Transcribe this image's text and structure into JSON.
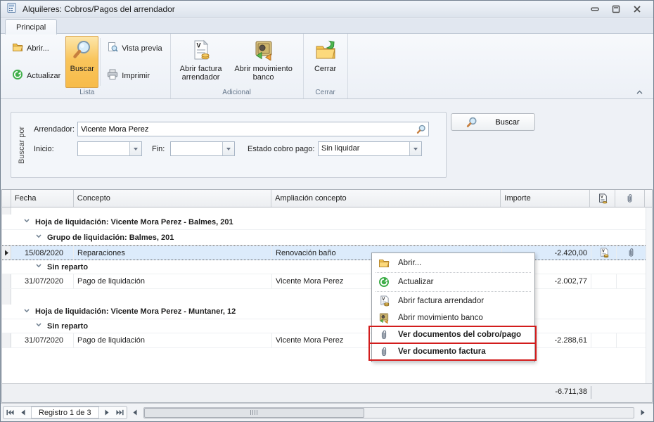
{
  "window": {
    "title": "Alquileres: Cobros/Pagos del arrendador"
  },
  "ribbon": {
    "tab": "Principal",
    "groups": {
      "lista": {
        "label": "Lista",
        "abrir": "Abrir...",
        "actualizar": "Actualizar",
        "buscar": "Buscar",
        "vista_previa": "Vista previa",
        "imprimir": "Imprimir"
      },
      "adicional": {
        "label": "Adicional",
        "abrir_factura": "Abrir factura arrendador",
        "abrir_movimiento": "Abrir movimiento banco"
      },
      "cerrar": {
        "label": "Cerrar",
        "cerrar": "Cerrar"
      }
    }
  },
  "search": {
    "side_label": "Buscar por",
    "arrendador_label": "Arrendador:",
    "arrendador_value": "Vicente Mora Perez",
    "inicio_label": "Inicio:",
    "inicio_value": "",
    "fin_label": "Fin:",
    "fin_value": "",
    "estado_label": "Estado cobro pago:",
    "estado_value": "Sin liquidar",
    "buscar_button": "Buscar"
  },
  "grid": {
    "columns": {
      "fecha": "Fecha",
      "concepto": "Concepto",
      "ampliacion": "Ampliación concepto",
      "importe": "Importe"
    },
    "rows": [
      {
        "type": "group",
        "level": 1,
        "label": "Hoja de liquidación: Vicente Mora Perez - Balmes, 201"
      },
      {
        "type": "group",
        "level": 2,
        "label": "Grupo de liquidación: Balmes, 201"
      },
      {
        "type": "data",
        "selected": true,
        "fecha": "15/08/2020",
        "concepto": "Reparaciones",
        "ampliacion": "Renovación baño",
        "importe": "-2.420,00",
        "factura_icon": true,
        "clip_icon": true
      },
      {
        "type": "group",
        "level": 2,
        "label": "Sin reparto"
      },
      {
        "type": "data",
        "fecha": "31/07/2020",
        "concepto": "Pago de liquidación",
        "ampliacion": "Vicente Mora Perez",
        "importe": "-2.002,77"
      },
      {
        "type": "group",
        "level": 1,
        "label": "Hoja de liquidación: Vicente Mora Perez - Muntaner, 12"
      },
      {
        "type": "group",
        "level": 2,
        "label": "Sin reparto"
      },
      {
        "type": "data",
        "fecha": "31/07/2020",
        "concepto": "Pago de liquidación",
        "ampliacion": "Vicente Mora Perez",
        "importe": "-2.288,61"
      }
    ],
    "total": "-6.711,38"
  },
  "context_menu": {
    "highlight_color": "#d21c1c",
    "items": [
      {
        "icon": "folder-open-icon",
        "label": "Abrir...",
        "highlighted": false
      },
      {
        "icon": "refresh-icon",
        "label": "Actualizar",
        "highlighted": false
      },
      {
        "icon": "invoice-icon",
        "label": "Abrir factura arrendador",
        "highlighted": false
      },
      {
        "icon": "safe-icon",
        "label": "Abrir movimiento banco",
        "highlighted": false
      },
      {
        "icon": "paperclip-icon",
        "label": "Ver documentos del cobro/pago",
        "highlighted": true
      },
      {
        "icon": "paperclip-icon",
        "label": "Ver documento factura",
        "highlighted": true
      }
    ]
  },
  "statusbar": {
    "record_label": "Registro 1 de 3"
  },
  "colors": {
    "selected_row": "#dcebfb",
    "buscar_button_accent": "#f9c55c",
    "annotation_red": "#d21c1c",
    "titlebar": "#e4eaf2",
    "ribbon_bg": "#f2f5fa"
  }
}
